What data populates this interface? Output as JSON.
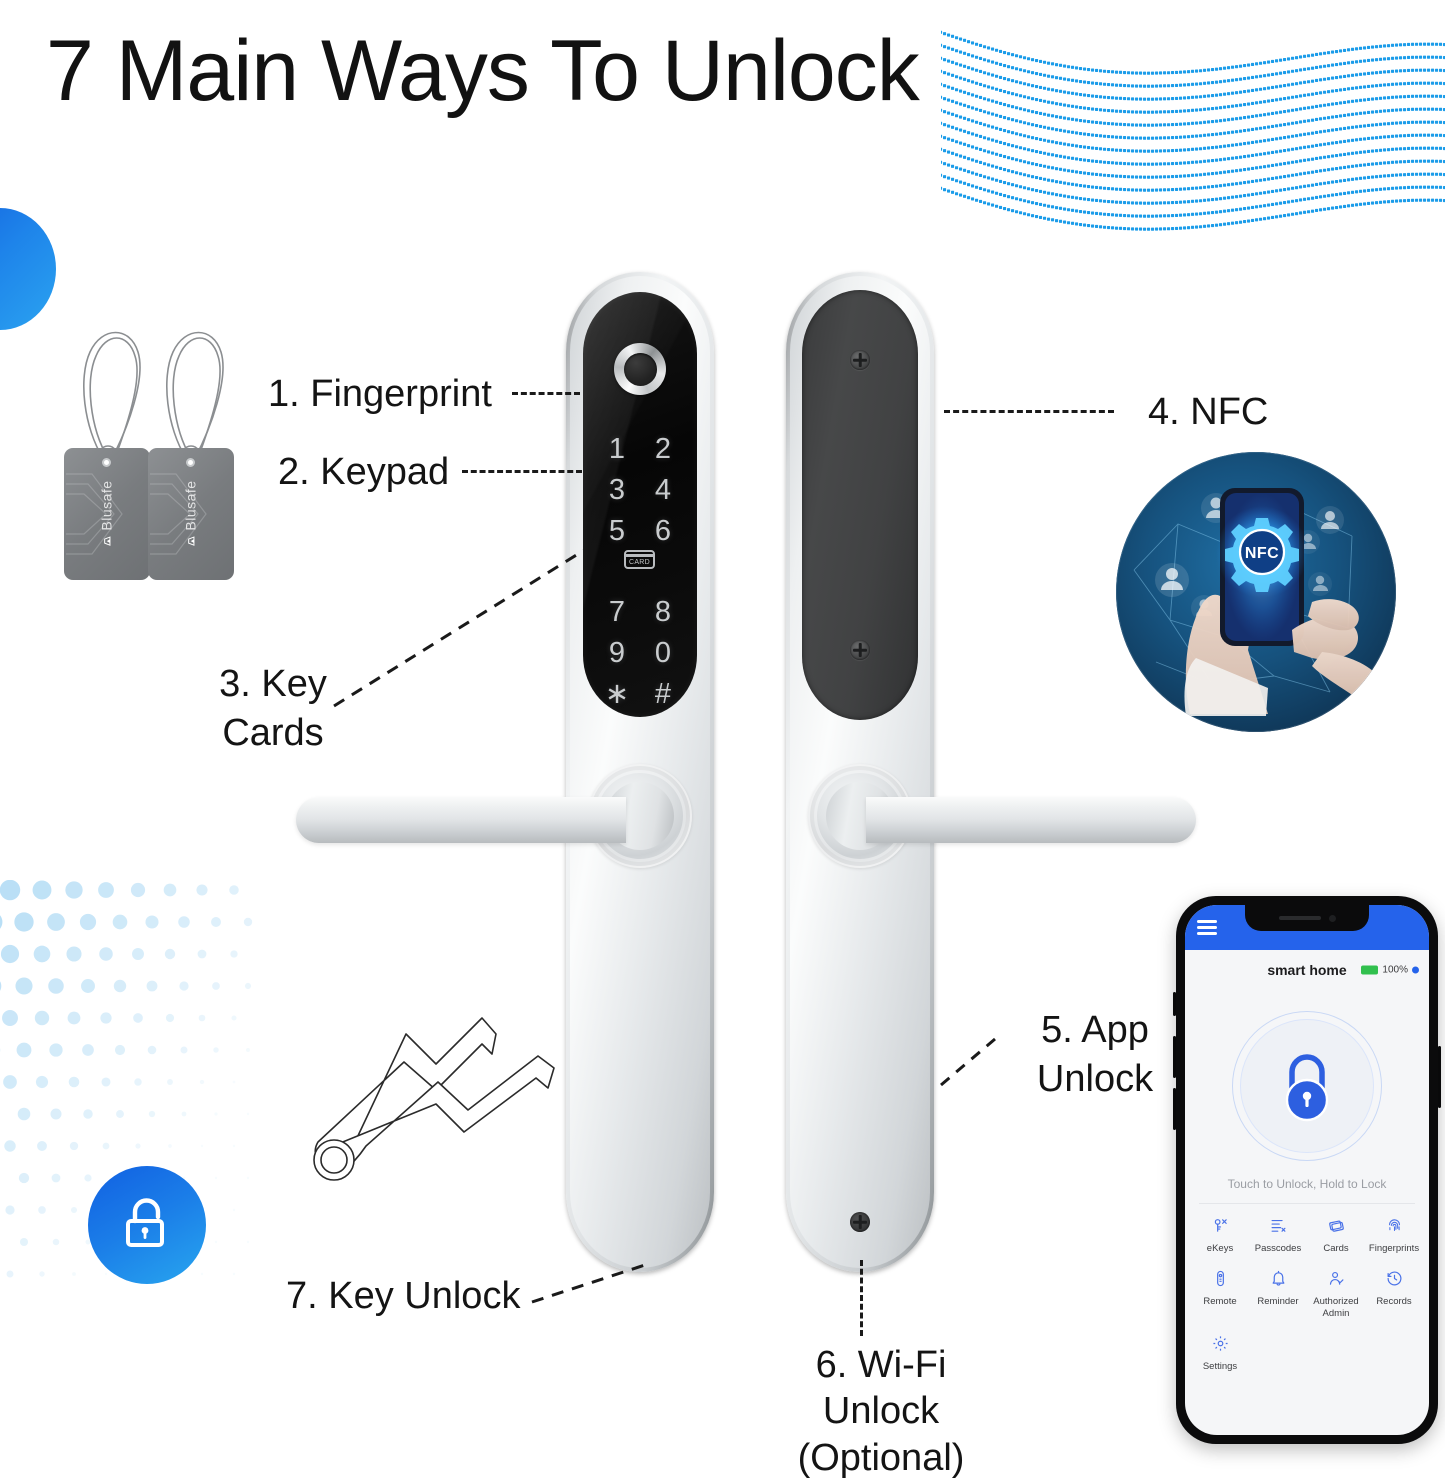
{
  "page": {
    "title": "7 Main Ways To Unlock",
    "background_color": "#ffffff",
    "accent_blue": "#2196f3",
    "accent_blue_dark": "#1565e0",
    "app_blue": "#2563eb"
  },
  "callouts": [
    {
      "id": "fingerprint",
      "label": "1.  Fingerprint"
    },
    {
      "id": "keypad",
      "label": "2. Keypad"
    },
    {
      "id": "keycards",
      "label": "3. Key Cards"
    },
    {
      "id": "nfc",
      "label": "4. NFC"
    },
    {
      "id": "app",
      "label": "5. App Unlock"
    },
    {
      "id": "wifi",
      "label": "6. Wi-Fi Unlock (Optional)"
    },
    {
      "id": "key",
      "label": "7. Key Unlock"
    }
  ],
  "lock": {
    "keypad_rows": [
      [
        "1",
        "2"
      ],
      [
        "3",
        "4"
      ],
      [
        "5",
        "6"
      ],
      [
        "7",
        "8"
      ],
      [
        "9",
        "0"
      ],
      [
        "∗",
        "#"
      ]
    ],
    "card_glyph_label": "CARD",
    "front_panel_name": "front-panel",
    "back_panel_name": "back-panel"
  },
  "keycards": {
    "brand": "Blusafe",
    "count": 2
  },
  "nfc_image": {
    "badge_text": "NFC",
    "caption": "hands holding smartphone with glowing NFC network graphic"
  },
  "app": {
    "title": "smart home",
    "battery": "100%",
    "hint": "Touch to Unlock, Hold to Lock",
    "tiles": [
      {
        "label": "eKeys",
        "icon": "ekey-icon"
      },
      {
        "label": "Passcodes",
        "icon": "passcode-list-icon"
      },
      {
        "label": "Cards",
        "icon": "cards-icon"
      },
      {
        "label": "Fingerprints",
        "icon": "fingerprint-icon"
      },
      {
        "label": "Remote",
        "icon": "remote-icon"
      },
      {
        "label": "Reminder",
        "icon": "bell-icon"
      },
      {
        "label": "Authorized Admin",
        "icon": "admin-user-icon"
      },
      {
        "label": "Records",
        "icon": "history-clock-icon"
      },
      {
        "label": "Settings",
        "icon": "gear-icon"
      }
    ]
  }
}
